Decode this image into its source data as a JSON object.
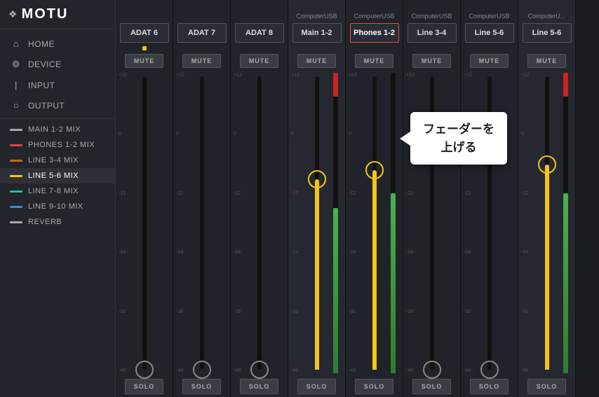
{
  "app": {
    "name": "MOTU",
    "logo_icon": "❖"
  },
  "sidebar": {
    "nav_items": [
      {
        "id": "home",
        "label": "HOME",
        "icon": "⌂",
        "active": false
      },
      {
        "id": "device",
        "label": "DEVICE",
        "icon": "⚙",
        "active": false
      },
      {
        "id": "input",
        "label": "INPUT",
        "icon": "|",
        "active": false
      },
      {
        "id": "output",
        "label": "OUTPUT",
        "icon": "○",
        "active": false
      }
    ],
    "mix_items": [
      {
        "id": "main12",
        "label": "MAIN 1-2 MIX",
        "color": "#aaa",
        "active": false
      },
      {
        "id": "phones12",
        "label": "PHONES 1-2 MIX",
        "color": "#e04444",
        "active": false
      },
      {
        "id": "line34",
        "label": "LINE 3-4 MIX",
        "color": "#cc6622",
        "active": false
      },
      {
        "id": "line56",
        "label": "LINE 5-6 MIX",
        "color": "#f5c518",
        "active": true
      },
      {
        "id": "line78",
        "label": "LINE 7-8 MIX",
        "color": "#22bbaa",
        "active": false
      },
      {
        "id": "line910",
        "label": "LINE 9-10 MIX",
        "color": "#4488cc",
        "active": false
      },
      {
        "id": "reverb",
        "label": "REVERB",
        "color": "#aaa",
        "active": false
      }
    ]
  },
  "channels": [
    {
      "id": "adat6",
      "top_label": "",
      "name": "ADAT 6",
      "name_selected": false,
      "indicator": "yellow",
      "fader_pct": 0,
      "meter_pct": 0,
      "has_meter_red": false
    },
    {
      "id": "adat7",
      "top_label": "",
      "name": "ADAT 7",
      "name_selected": false,
      "indicator": "none",
      "fader_pct": 0,
      "meter_pct": 0,
      "has_meter_red": false
    },
    {
      "id": "adat8",
      "top_label": "",
      "name": "ADAT 8",
      "name_selected": false,
      "indicator": "none",
      "fader_pct": 0,
      "meter_pct": 0,
      "has_meter_red": false
    },
    {
      "id": "main12",
      "top_label": "Computer\nUSB",
      "name": "Main 1-2",
      "name_selected": false,
      "indicator": "none",
      "fader_pct": 65,
      "meter_pct": 55,
      "has_meter_red": true,
      "highlighted": true
    },
    {
      "id": "phones12",
      "top_label": "Computer\nUSB",
      "name": "Phones 1-2",
      "name_selected": true,
      "indicator": "none",
      "fader_pct": 68,
      "meter_pct": 60,
      "has_meter_red": false
    },
    {
      "id": "line34",
      "top_label": "Computer\nUSB",
      "name": "Line 3-4",
      "name_selected": false,
      "indicator": "none",
      "fader_pct": 0,
      "meter_pct": 0,
      "has_meter_red": false
    },
    {
      "id": "line56",
      "top_label": "Computer\nUSB",
      "name": "Line 5-6",
      "name_selected": false,
      "indicator": "none",
      "fader_pct": 0,
      "meter_pct": 0,
      "has_meter_red": false
    },
    {
      "id": "line56b",
      "top_label": "Computer\nU...",
      "name": "Line 5-6",
      "name_selected": false,
      "indicator": "none",
      "fader_pct": 70,
      "meter_pct": 60,
      "has_meter_red": true,
      "highlighted": true
    }
  ],
  "callout": {
    "text_line1": "フェーダーを",
    "text_line2": "上げる"
  },
  "labels": {
    "mute": "MUTE",
    "solo": "SOLO"
  },
  "scale": [
    "+12",
    "0",
    "-12",
    "-24",
    "-36",
    "-48"
  ]
}
